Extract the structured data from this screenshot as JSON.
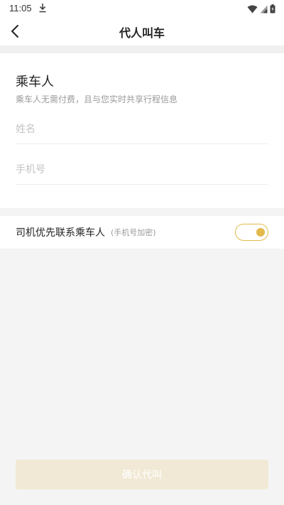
{
  "status": {
    "time": "11:05",
    "icons": [
      "download-icon",
      "wifi-icon",
      "signal-icon",
      "battery-icon"
    ]
  },
  "nav": {
    "title": "代人叫车"
  },
  "passenger": {
    "title": "乘车人",
    "desc": "乘车人无需付费，且与您实时共享行程信息",
    "name_placeholder": "姓名",
    "phone_placeholder": "手机号"
  },
  "contact": {
    "label": "司机优先联系乘车人",
    "hint": "(手机号加密)",
    "enabled": true
  },
  "footer": {
    "confirm_label": "确认代叫"
  },
  "colors": {
    "accent": "#e2b94a",
    "button_disabled": "#f1e9d5",
    "background": "#f4f4f4"
  }
}
